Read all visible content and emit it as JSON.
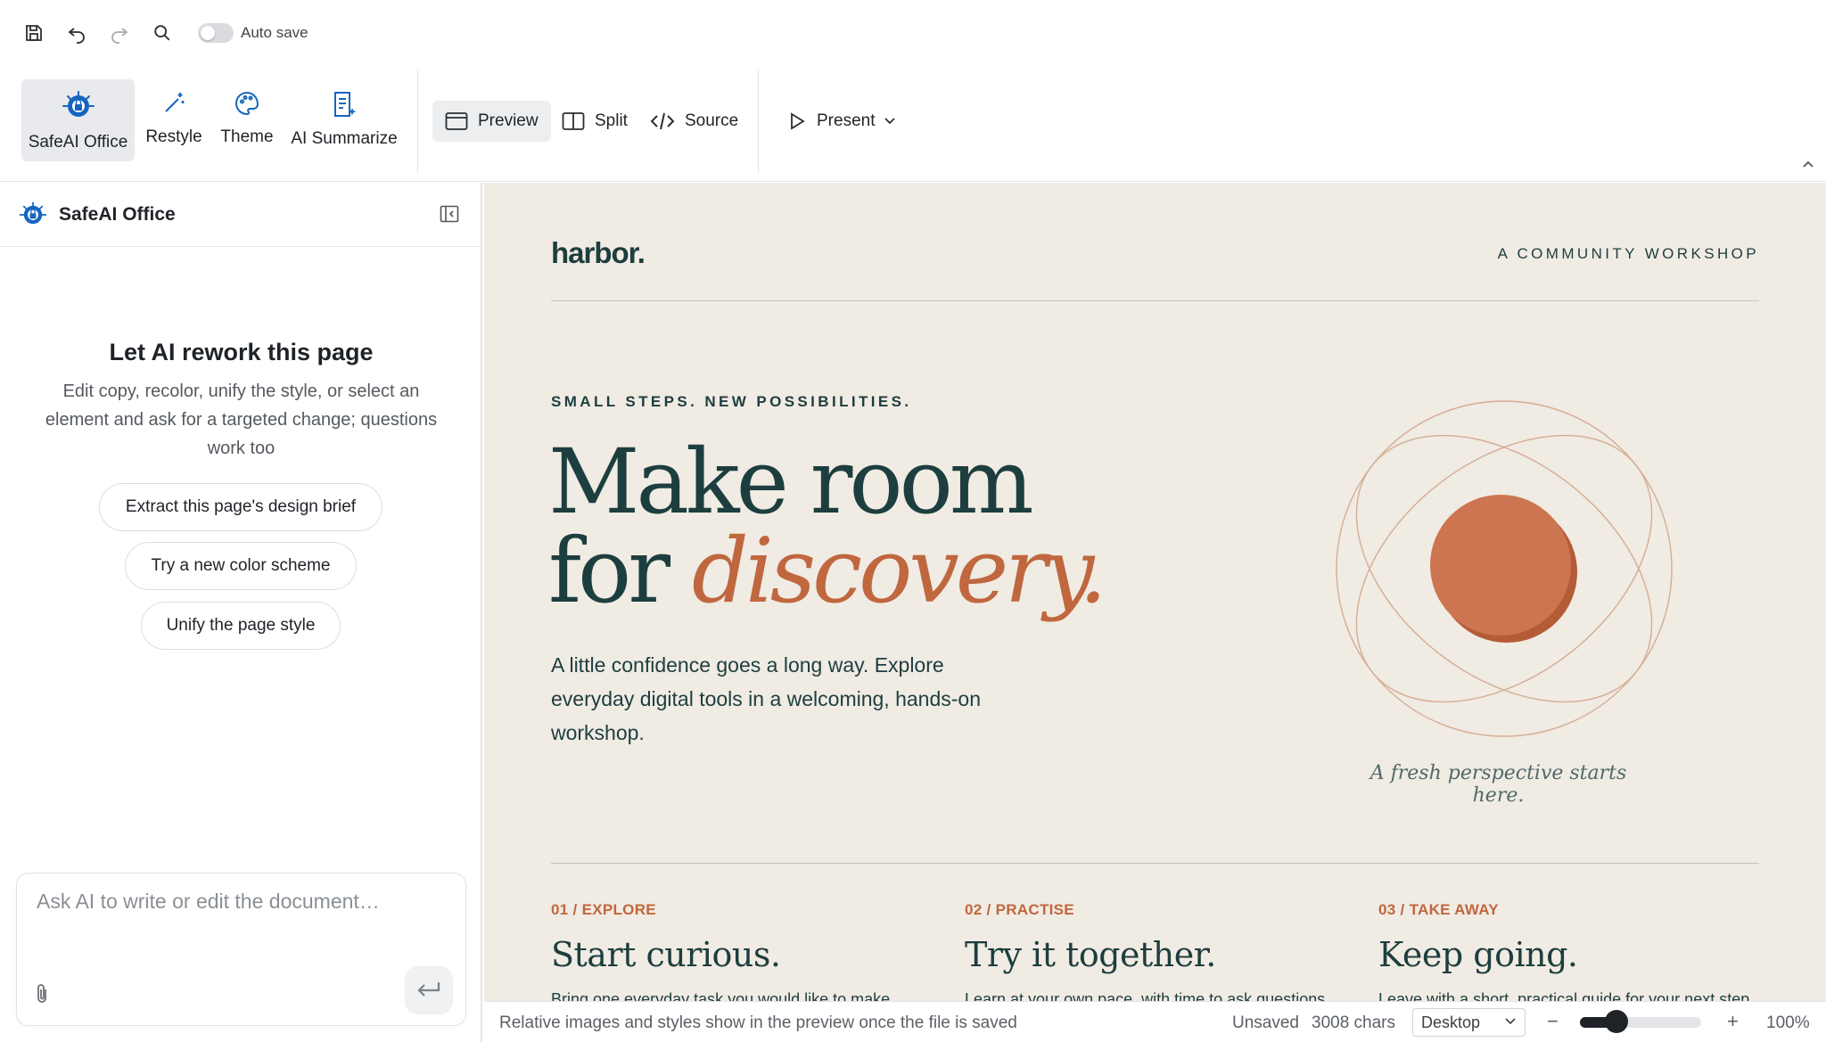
{
  "toolbar": {
    "autosave_label": "Auto save",
    "autosave_on": false
  },
  "ribbon": {
    "tools": [
      {
        "label": "SafeAI Office",
        "icon": "safeai-logo-icon",
        "active": true
      },
      {
        "label": "Restyle",
        "icon": "magic-wand-icon"
      },
      {
        "label": "Theme",
        "icon": "palette-icon"
      },
      {
        "label": "AI Summarize",
        "icon": "document-sparkle-icon"
      }
    ],
    "views": [
      {
        "label": "Preview",
        "icon": "preview-window-icon",
        "active": true
      },
      {
        "label": "Split",
        "icon": "split-columns-icon"
      },
      {
        "label": "Source",
        "icon": "code-icon"
      }
    ],
    "present_label": "Present"
  },
  "sidebar": {
    "title": "SafeAI Office",
    "heading": "Let AI rework this page",
    "subtext": "Edit copy, recolor, unify the style, or select an element and ask for a targeted change; questions work too",
    "suggestions": [
      "Extract this page's design brief",
      "Try a new color scheme",
      "Unify the page style"
    ],
    "input_placeholder": "Ask AI to write or edit the document…"
  },
  "preview": {
    "brand": "harbor.",
    "tagline": "A COMMUNITY WORKSHOP",
    "kicker": "SMALL STEPS. NEW POSSIBILITIES.",
    "headline_line1": "Make room",
    "headline_line2_prefix": "for ",
    "headline_accent": "discovery.",
    "lede": "A little confidence goes a long way. Explore everyday digital tools in a welcoming, hands-on workshop.",
    "caption": "A fresh perspective starts here.",
    "steps": [
      {
        "num": "01 / EXPLORE",
        "title": "Start curious.",
        "body": "Bring one everyday task you would like to make"
      },
      {
        "num": "02 / PRACTISE",
        "title": "Try it together.",
        "body": "Learn at your own pace, with time to ask questions"
      },
      {
        "num": "03 / TAKE AWAY",
        "title": "Keep going.",
        "body": "Leave with a short, practical guide for your next step"
      }
    ],
    "colors": {
      "ink": "#1d3e3f",
      "accent": "#c0673f",
      "paper": "#f0ebe3"
    }
  },
  "status": {
    "hint": "Relative images and styles show in the preview once the file is saved",
    "unsaved": "Unsaved",
    "chars": "3008 chars",
    "device": "Desktop",
    "zoom_minus": "−",
    "zoom_plus": "+",
    "zoom": "100%",
    "zoom_level": 0.3
  }
}
